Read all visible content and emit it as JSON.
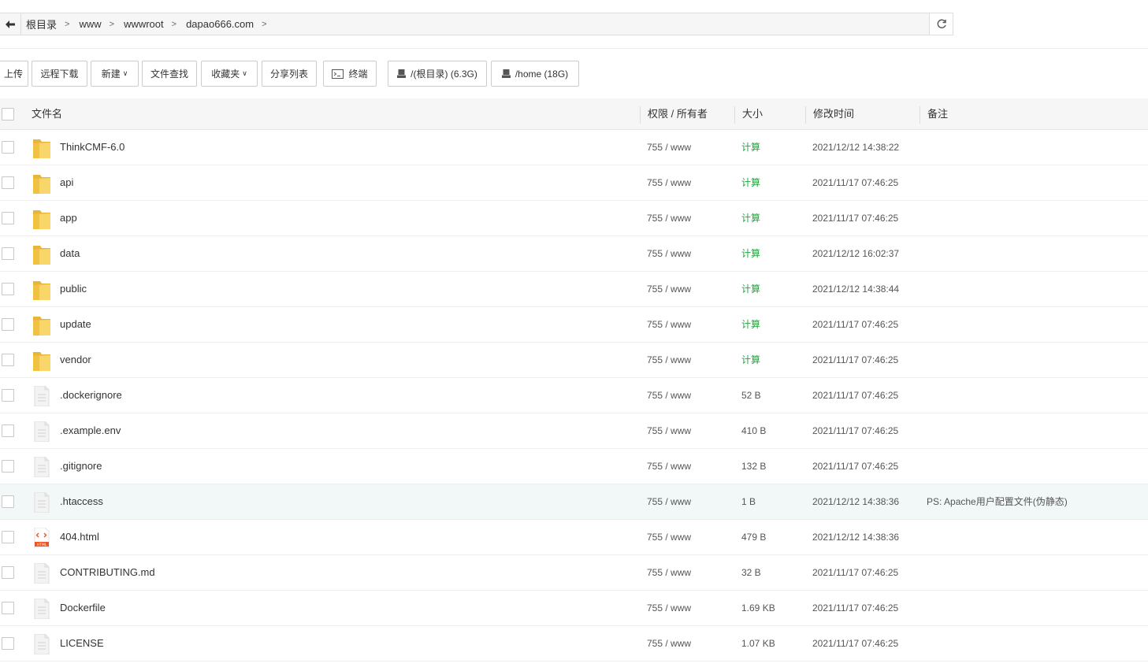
{
  "path": {
    "crumbs": [
      "根目录",
      "www",
      "wwwroot",
      "dapao666.com"
    ]
  },
  "toolbar": {
    "upload": "上传",
    "remote_download": "远程下载",
    "new": "新建",
    "file_search": "文件查找",
    "favorites": "收藏夹",
    "share_list": "分享列表",
    "terminal": "终端",
    "disk_root": "/(根目录) (6.3G)",
    "disk_home": "/home (18G)"
  },
  "table": {
    "headers": {
      "name": "文件名",
      "perm": "权限 / 所有者",
      "size": "大小",
      "mtime": "修改时间",
      "note": "备注"
    },
    "rows": [
      {
        "name": "ThinkCMF-6.0",
        "type": "folder",
        "perm": "755 / www",
        "size": "计算",
        "mtime": "2021/12/12 14:38:22",
        "note": ""
      },
      {
        "name": "api",
        "type": "folder",
        "perm": "755 / www",
        "size": "计算",
        "mtime": "2021/11/17 07:46:25",
        "note": ""
      },
      {
        "name": "app",
        "type": "folder",
        "perm": "755 / www",
        "size": "计算",
        "mtime": "2021/11/17 07:46:25",
        "note": ""
      },
      {
        "name": "data",
        "type": "folder",
        "perm": "755 / www",
        "size": "计算",
        "mtime": "2021/12/12 16:02:37",
        "note": ""
      },
      {
        "name": "public",
        "type": "folder",
        "perm": "755 / www",
        "size": "计算",
        "mtime": "2021/12/12 14:38:44",
        "note": ""
      },
      {
        "name": "update",
        "type": "folder",
        "perm": "755 / www",
        "size": "计算",
        "mtime": "2021/11/17 07:46:25",
        "note": ""
      },
      {
        "name": "vendor",
        "type": "folder",
        "perm": "755 / www",
        "size": "计算",
        "mtime": "2021/11/17 07:46:25",
        "note": ""
      },
      {
        "name": ".dockerignore",
        "type": "file",
        "perm": "755 / www",
        "size": "52 B",
        "mtime": "2021/11/17 07:46:25",
        "note": ""
      },
      {
        "name": ".example.env",
        "type": "file",
        "perm": "755 / www",
        "size": "410 B",
        "mtime": "2021/11/17 07:46:25",
        "note": ""
      },
      {
        "name": ".gitignore",
        "type": "file",
        "perm": "755 / www",
        "size": "132 B",
        "mtime": "2021/11/17 07:46:25",
        "note": ""
      },
      {
        "name": ".htaccess",
        "type": "file",
        "perm": "755 / www",
        "size": "1 B",
        "mtime": "2021/12/12 14:38:36",
        "note": "PS: Apache用户配置文件(伪静态)",
        "highlight": true
      },
      {
        "name": "404.html",
        "type": "html",
        "perm": "755 / www",
        "size": "479 B",
        "mtime": "2021/12/12 14:38:36",
        "note": ""
      },
      {
        "name": "CONTRIBUTING.md",
        "type": "file",
        "perm": "755 / www",
        "size": "32 B",
        "mtime": "2021/11/17 07:46:25",
        "note": ""
      },
      {
        "name": "Dockerfile",
        "type": "file",
        "perm": "755 / www",
        "size": "1.69 KB",
        "mtime": "2021/11/17 07:46:25",
        "note": ""
      },
      {
        "name": "LICENSE",
        "type": "file",
        "perm": "755 / www",
        "size": "1.07 KB",
        "mtime": "2021/11/17 07:46:25",
        "note": ""
      }
    ]
  },
  "colors": {
    "calc_link": "#20a53a",
    "folder": "#f5c94a",
    "html_icon": "#e8562a"
  }
}
